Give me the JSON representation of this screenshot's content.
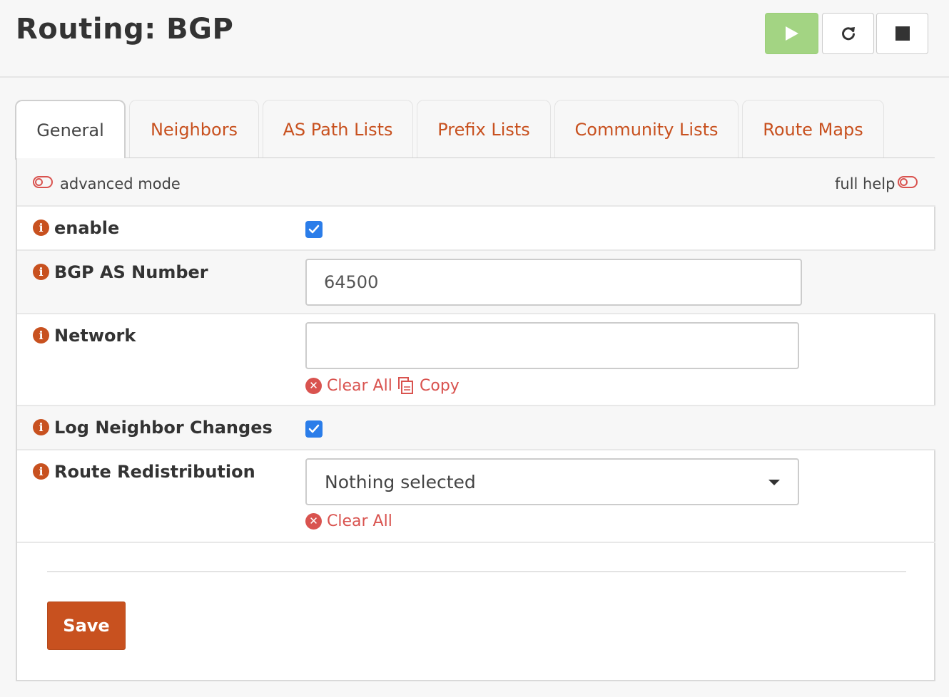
{
  "header": {
    "title": "Routing: BGP",
    "start_icon": "play-icon",
    "restart_icon": "refresh-icon",
    "stop_icon": "stop-icon"
  },
  "tabs": [
    {
      "label": "General",
      "active": true
    },
    {
      "label": "Neighbors",
      "active": false
    },
    {
      "label": "AS Path Lists",
      "active": false
    },
    {
      "label": "Prefix Lists",
      "active": false
    },
    {
      "label": "Community Lists",
      "active": false
    },
    {
      "label": "Route Maps",
      "active": false
    }
  ],
  "form": {
    "advanced_mode_label": "advanced mode",
    "full_help_label": "full help",
    "fields": {
      "enable": {
        "label": "enable",
        "checked": true
      },
      "as_number": {
        "label": "BGP AS Number",
        "value": "64500"
      },
      "network": {
        "label": "Network",
        "value": "",
        "clear_label": "Clear All",
        "copy_label": "Copy"
      },
      "log_neighbor_changes": {
        "label": "Log Neighbor Changes",
        "checked": true
      },
      "route_redistribution": {
        "label": "Route Redistribution",
        "selected": "Nothing selected",
        "clear_label": "Clear All"
      }
    },
    "save_label": "Save"
  },
  "colors": {
    "accent": "#c8511f",
    "start_button": "#a3d483",
    "checkbox": "#2b7de9",
    "danger": "#d9534f"
  }
}
